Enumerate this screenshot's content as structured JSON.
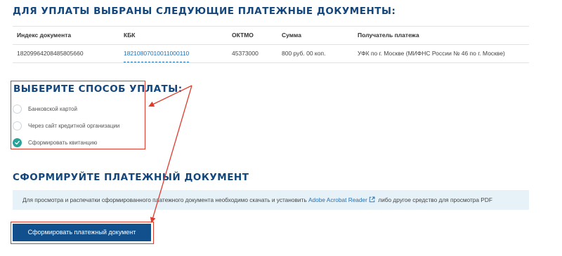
{
  "documents": {
    "title": "Для уплаты выбраны следующие платежные документы:",
    "columns": [
      "Индекс документа",
      "КБК",
      "ОКТМО",
      "Сумма",
      "Получатель платежа"
    ],
    "rows": [
      {
        "index": "18209964208485805660",
        "kbk": "18210807010011000110",
        "oktmo": "45373000",
        "amount": "800 руб. 00 коп.",
        "recipient": "УФК по г. Москве (МИФНС России № 46 по г. Москве)"
      }
    ]
  },
  "payment_method": {
    "title": "Выберите способ уплаты:",
    "options": [
      {
        "label": "Банковской картой",
        "selected": false
      },
      {
        "label": "Через сайт кредитной организации",
        "selected": false
      },
      {
        "label": "Сформировать квитанцию",
        "selected": true
      }
    ]
  },
  "form": {
    "title": "Сформируйте платежный документ",
    "info_prefix": "Для просмотра и распечатки сформированного платежного документа необходимо скачать и установить",
    "info_link": "Adobe Acrobat Reader",
    "info_suffix": "либо другое средство для просмотра PDF",
    "button_label": "Сформировать платежный документ"
  },
  "colors": {
    "heading": "#12467c",
    "link": "#1f6fb5",
    "accent_check": "#2aa39a",
    "button": "#11508d",
    "annotation": "#e03a2d",
    "banner": "#e7f2f8"
  }
}
